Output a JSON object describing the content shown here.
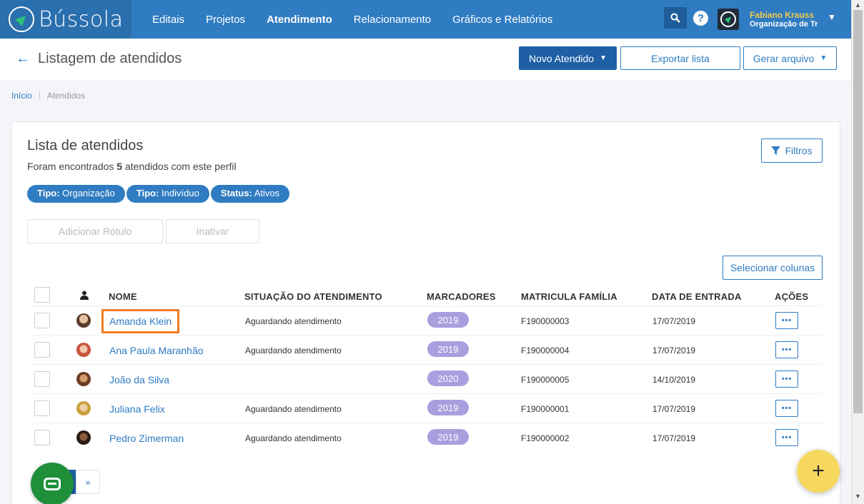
{
  "brand": {
    "name": "Bússola"
  },
  "nav": {
    "items": [
      "Editais",
      "Projetos",
      "Atendimento",
      "Relacionamento",
      "Gráficos e Relatórios"
    ],
    "active": "Atendimento"
  },
  "user": {
    "name": "Fabiano Krauss",
    "org": "Organização de Tre"
  },
  "header": {
    "title": "Listagem de atendidos",
    "new_button": "Novo Atendido",
    "export_button": "Exportar lista",
    "generate_button": "Gerar arquivo"
  },
  "breadcrumb": {
    "home": "Início",
    "current": "Atendidos"
  },
  "card": {
    "title": "Lista de atendidos",
    "found_prefix": "Foram encontrados",
    "found_count": "5",
    "found_suffix": "atendidos com este perfil",
    "filters_button": "Filtros",
    "chips": [
      {
        "key": "Tipo:",
        "value": "Organização"
      },
      {
        "key": "Tipo:",
        "value": "Indivíduo"
      },
      {
        "key": "Status:",
        "value": "Ativos"
      }
    ],
    "add_label_button": "Adicionar Rótulo",
    "deactivate_button": "Inativar",
    "select_columns_button": "Selecionar colunas"
  },
  "table": {
    "headers": [
      "NOME",
      "SITUAÇÃO DO ATENDIMENTO",
      "MARCADORES",
      "MATRICULA FAMÍLIA",
      "DATA DE ENTRADA",
      "AÇÕES"
    ],
    "rows": [
      {
        "name": "Amanda Klein",
        "status": "Aguardando atendimento",
        "tag": "2019",
        "matricula": "F190000003",
        "date": "17/07/2019",
        "actions": "•••"
      },
      {
        "name": "Ana Paula Maranhão",
        "status": "Aguardando atendimento",
        "tag": "2019",
        "matricula": "F190000004",
        "date": "17/07/2019",
        "actions": "•••"
      },
      {
        "name": "João da Silva",
        "status": "",
        "tag": "2020",
        "matricula": "F190000005",
        "date": "14/10/2019",
        "actions": "•••"
      },
      {
        "name": "Juliana Felix",
        "status": "Aguardando atendimento",
        "tag": "2019",
        "matricula": "F190000001",
        "date": "17/07/2019",
        "actions": "•••"
      },
      {
        "name": "Pedro Zimerman",
        "status": "Aguardando atendimento",
        "tag": "2019",
        "matricula": "F190000002",
        "date": "17/07/2019",
        "actions": "•••"
      }
    ]
  },
  "pager": {
    "next": "»"
  },
  "fab": {
    "label": "+"
  },
  "colors": {
    "primary": "#2f7cc2",
    "dark_primary": "#1f5fa5",
    "badge": "#a99ede",
    "highlight": "#f07c26",
    "fab": "#f6d860",
    "chat": "#1f8f3a"
  }
}
